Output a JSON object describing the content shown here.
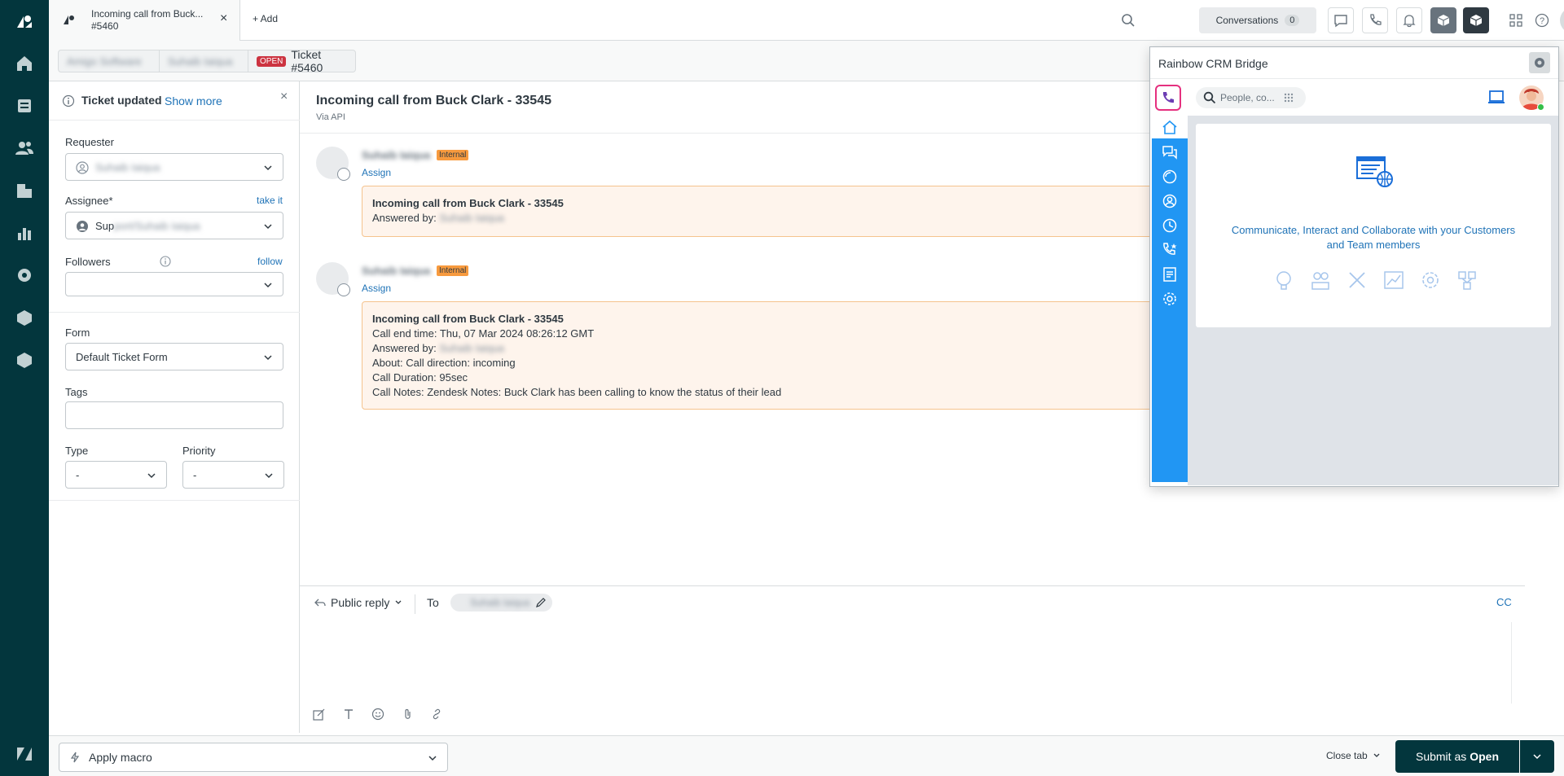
{
  "tab": {
    "title": "Incoming call from Buck...",
    "subtitle": "#5460",
    "close": "×",
    "add_label": "+ Add"
  },
  "top": {
    "conversations_label": "Conversations",
    "conversations_count": "0"
  },
  "breadcrumb": {
    "org": "Amigo Software",
    "user": "Suhaib Iaiqua",
    "status_badge": "OPEN",
    "ticket": "Ticket #5460"
  },
  "notice": {
    "text": "Ticket updated",
    "link": "Show more",
    "close": "×"
  },
  "fields": {
    "requester_label": "Requester",
    "requester_value": "Suhaib Iaiqua",
    "assignee_label": "Assignee*",
    "assignee_link": "take it",
    "assignee_value_prefix": "Sup",
    "assignee_value_blur": "port/Suhaib Iaiqua",
    "followers_label": "Followers",
    "followers_link": "follow",
    "form_label": "Form",
    "form_value": "Default Ticket Form",
    "tags_label": "Tags",
    "type_label": "Type",
    "type_value": "-",
    "priority_label": "Priority",
    "priority_value": "-"
  },
  "ticket": {
    "title": "Incoming call from Buck Clark - 33545",
    "via": "Via API"
  },
  "messages": [
    {
      "author": "Suhaib Iaiqua",
      "badge": "Internal",
      "assign": "Assign",
      "lines": [
        "Incoming call from Buck Clark - 33545",
        "Answered by:"
      ],
      "answered_by": "Suhaib Iaiqua"
    },
    {
      "author": "Suhaib Iaiqua",
      "badge": "Internal",
      "assign": "Assign",
      "title": "Incoming call from Buck Clark - 33545",
      "call_end": "Call end time: Thu, 07 Mar 2024 08:26:12 GMT",
      "answered_label": "Answered by:",
      "answered_by": "Suhaib Iaiqua",
      "about": "About: Call direction: incoming",
      "duration": "Call Duration: 95sec",
      "notes": "Call Notes: Zendesk Notes: Buck Clark has been calling to know the status of their lead"
    }
  ],
  "reply": {
    "mode": "Public reply",
    "to_label": "To",
    "to_value": "Suhaib Iaiqua",
    "cc": "CC"
  },
  "footer": {
    "macro": "Apply macro",
    "close_tab": "Close tab",
    "submit_prefix": "Submit as",
    "submit_status": "Open"
  },
  "crm": {
    "title": "Rainbow CRM Bridge",
    "search_placeholder": "People, co...",
    "tagline_line1": "Communicate, Interact and Collaborate with your Customers",
    "tagline_line2": "and Team members"
  },
  "colors": {
    "nav_bg": "#03363d",
    "accent": "#1f73b7",
    "crm_blue": "#2196f3",
    "submit_bg": "#03363d",
    "open_badge": "#cc3340",
    "internal_note_bg": "#fef4ec"
  }
}
